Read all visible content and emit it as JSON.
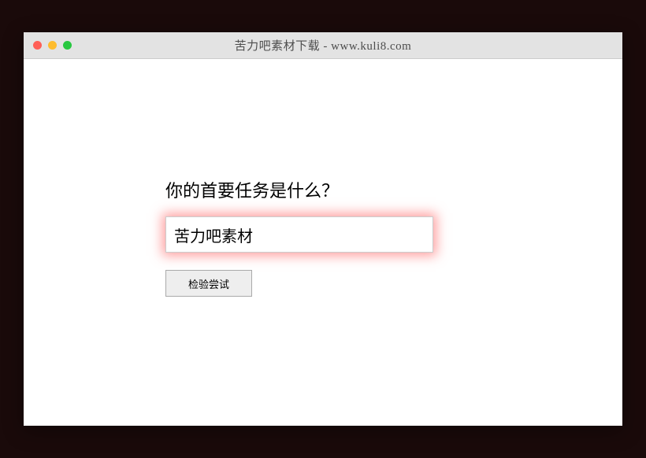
{
  "window": {
    "title": "苦力吧素材下载 - www.kuli8.com"
  },
  "form": {
    "question": "你的首要任务是什么？",
    "input_value": "苦力吧素材",
    "button_label": "检验尝试"
  }
}
